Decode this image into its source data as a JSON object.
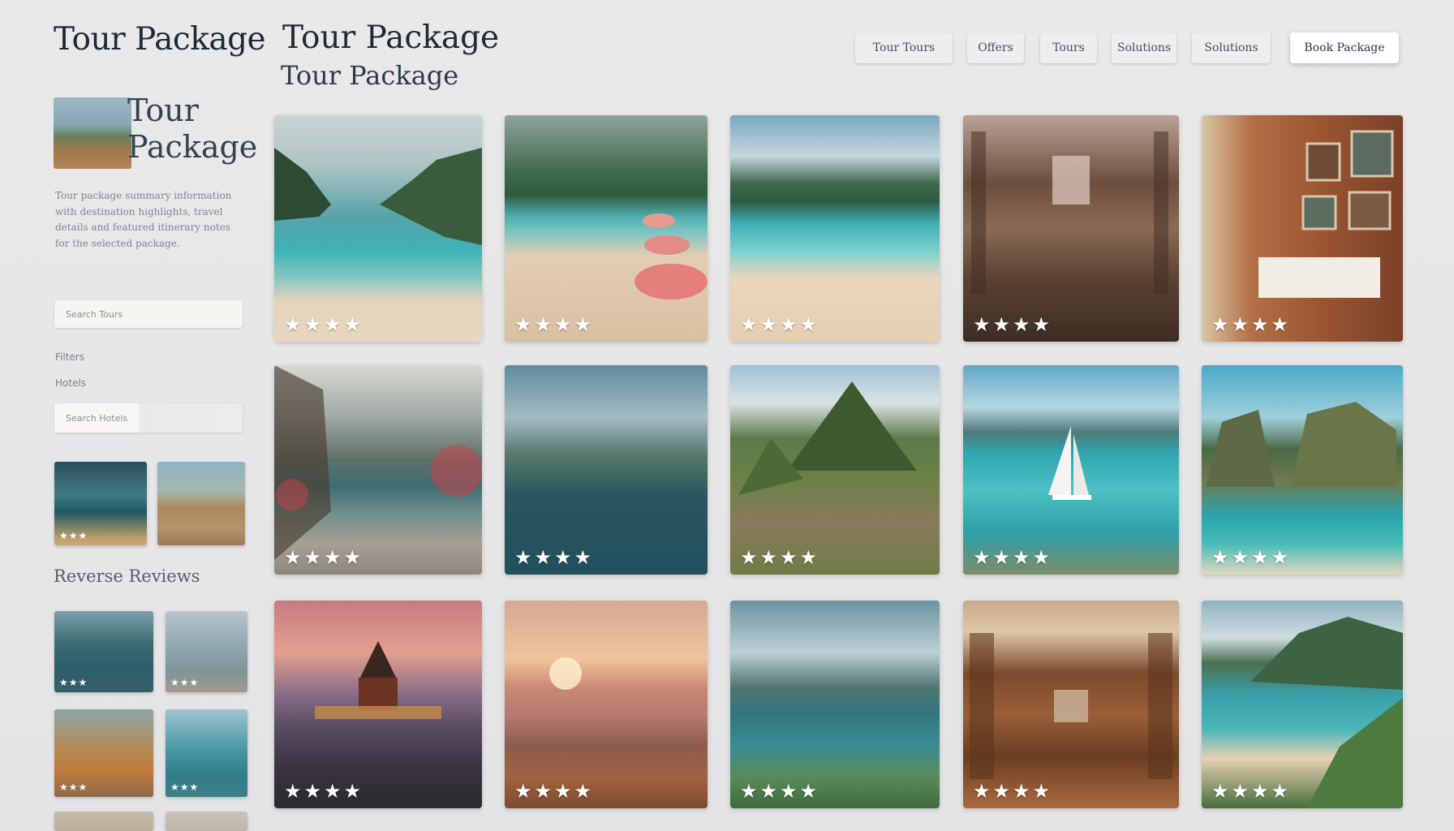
{
  "brand": "Tour Package",
  "sidebar": {
    "card_title": "Tour Package",
    "description": "Tour package summary information with destination highlights, travel details and featured itinerary notes for the selected package.",
    "search_placeholder": "Search Tours",
    "label_1": "Filters",
    "label_2": "Hotels",
    "search2_placeholder": "Search Hotels",
    "mini_stars": "★★★",
    "reviews_heading": "Reverse Reviews"
  },
  "header": {
    "title": "Tour Package",
    "subtitle": "Tour Package",
    "faint_text": "",
    "nav": [
      "Tour Tours",
      "Offers",
      "Tours",
      "Solutions",
      "Solutions"
    ],
    "primary_button": "Book Package"
  },
  "grid": {
    "cards": [
      {
        "stars": "★★★★",
        "caption": []
      },
      {
        "stars": "★★★★",
        "caption": []
      },
      {
        "stars": "★★★★",
        "caption": [
          "",
          ""
        ]
      },
      {
        "stars": "★★★★",
        "caption": []
      },
      {
        "stars": "★★★★",
        "caption": []
      },
      {
        "stars": "★★★★",
        "caption": []
      },
      {
        "stars": "★★★★",
        "caption": [
          "",
          ""
        ]
      },
      {
        "stars": "★★★★",
        "caption": []
      },
      {
        "stars": "★★★★",
        "caption": [
          "",
          ""
        ]
      },
      {
        "stars": "★★★★",
        "caption": []
      },
      {
        "stars": "★★★★",
        "caption": []
      },
      {
        "stars": "★★★★",
        "caption": []
      },
      {
        "stars": "★★★★",
        "caption": [
          "",
          ""
        ]
      },
      {
        "stars": "★★★★",
        "caption": []
      },
      {
        "stars": "★★★★",
        "caption": []
      }
    ]
  },
  "colors": {
    "background": "#e8e8e9",
    "text": "#1f2a33",
    "turquoise": "#3fb2b6",
    "sand": "#e9d6bf"
  }
}
